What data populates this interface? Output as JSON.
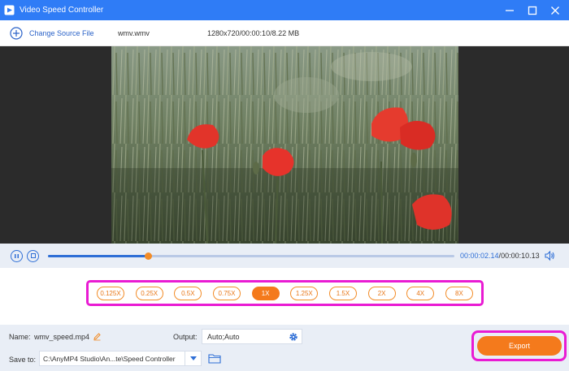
{
  "window": {
    "title": "Video Speed Controller"
  },
  "toolbar": {
    "change_source_label": "Change Source File",
    "filename": "wmv.wmv",
    "fileinfo": "1280x720/00:00:10/8.22 MB"
  },
  "player": {
    "current_time": "00:00:02.14",
    "separator": "/",
    "total_time": "00:00:10.13",
    "progress_percent": 24.5
  },
  "speeds": [
    {
      "label": "0.125X",
      "active": false
    },
    {
      "label": "0.25X",
      "active": false
    },
    {
      "label": "0.5X",
      "active": false
    },
    {
      "label": "0.75X",
      "active": false
    },
    {
      "label": "1X",
      "active": true
    },
    {
      "label": "1.25X",
      "active": false
    },
    {
      "label": "1.5X",
      "active": false
    },
    {
      "label": "2X",
      "active": false
    },
    {
      "label": "4X",
      "active": false
    },
    {
      "label": "8X",
      "active": false
    }
  ],
  "bottom": {
    "name_label": "Name:",
    "name_value": "wmv_speed.mp4",
    "output_label": "Output:",
    "output_value": "Auto;Auto",
    "saveto_label": "Save to:",
    "saveto_value": "C:\\AnyMP4 Studio\\An...te\\Speed Controller",
    "export_label": "Export"
  },
  "colors": {
    "accent_blue": "#2f7cf6",
    "accent_orange": "#f47a1c",
    "highlight_magenta": "#e91bd3"
  },
  "icons": {
    "app": "app-logo-icon",
    "minimize": "minimize-icon",
    "maximize": "maximize-icon",
    "close": "close-icon",
    "add": "plus-circle-icon",
    "play": "pause-icon",
    "stop": "stop-icon",
    "volume": "volume-icon",
    "edit": "pencil-icon",
    "gear": "gear-icon",
    "dropdown": "chevron-down-icon",
    "folder": "folder-icon"
  }
}
